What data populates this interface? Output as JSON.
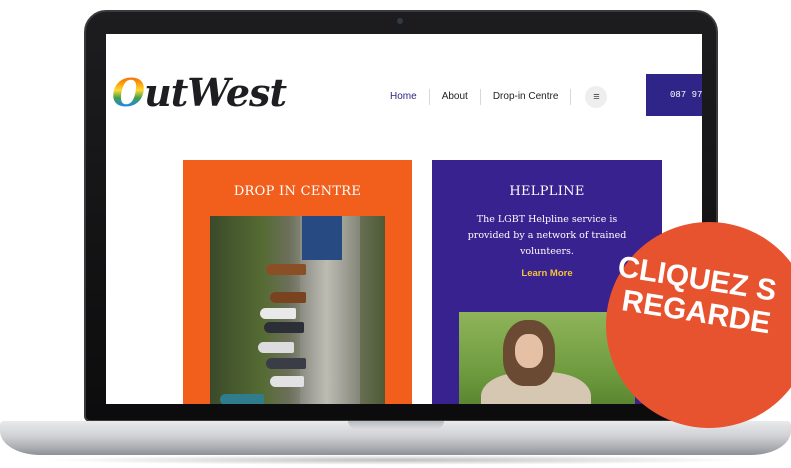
{
  "site": {
    "logo_text": "OutWest",
    "nav": {
      "items": [
        "Home",
        "About",
        "Drop-in Centre"
      ],
      "active": "Home",
      "menu_icon": "hamburger-menu-icon"
    },
    "phone_button_label": "087 97"
  },
  "cards": {
    "drop_in": {
      "title": "DROP IN CENTRE",
      "color": "#f25f1c"
    },
    "helpline": {
      "title": "HELPLINE",
      "description": "The LGBT Helpline service is provided by a network of trained volunteers.",
      "link_label": "Learn More",
      "color": "#38228f",
      "link_color": "#f4c23a"
    }
  },
  "promo_badge": {
    "line1": "CLIQUEZ S",
    "line2": "REGARDE",
    "color": "#e8532f"
  },
  "colors": {
    "brand_purple": "#2f2487",
    "accent_orange": "#f25f1c"
  }
}
